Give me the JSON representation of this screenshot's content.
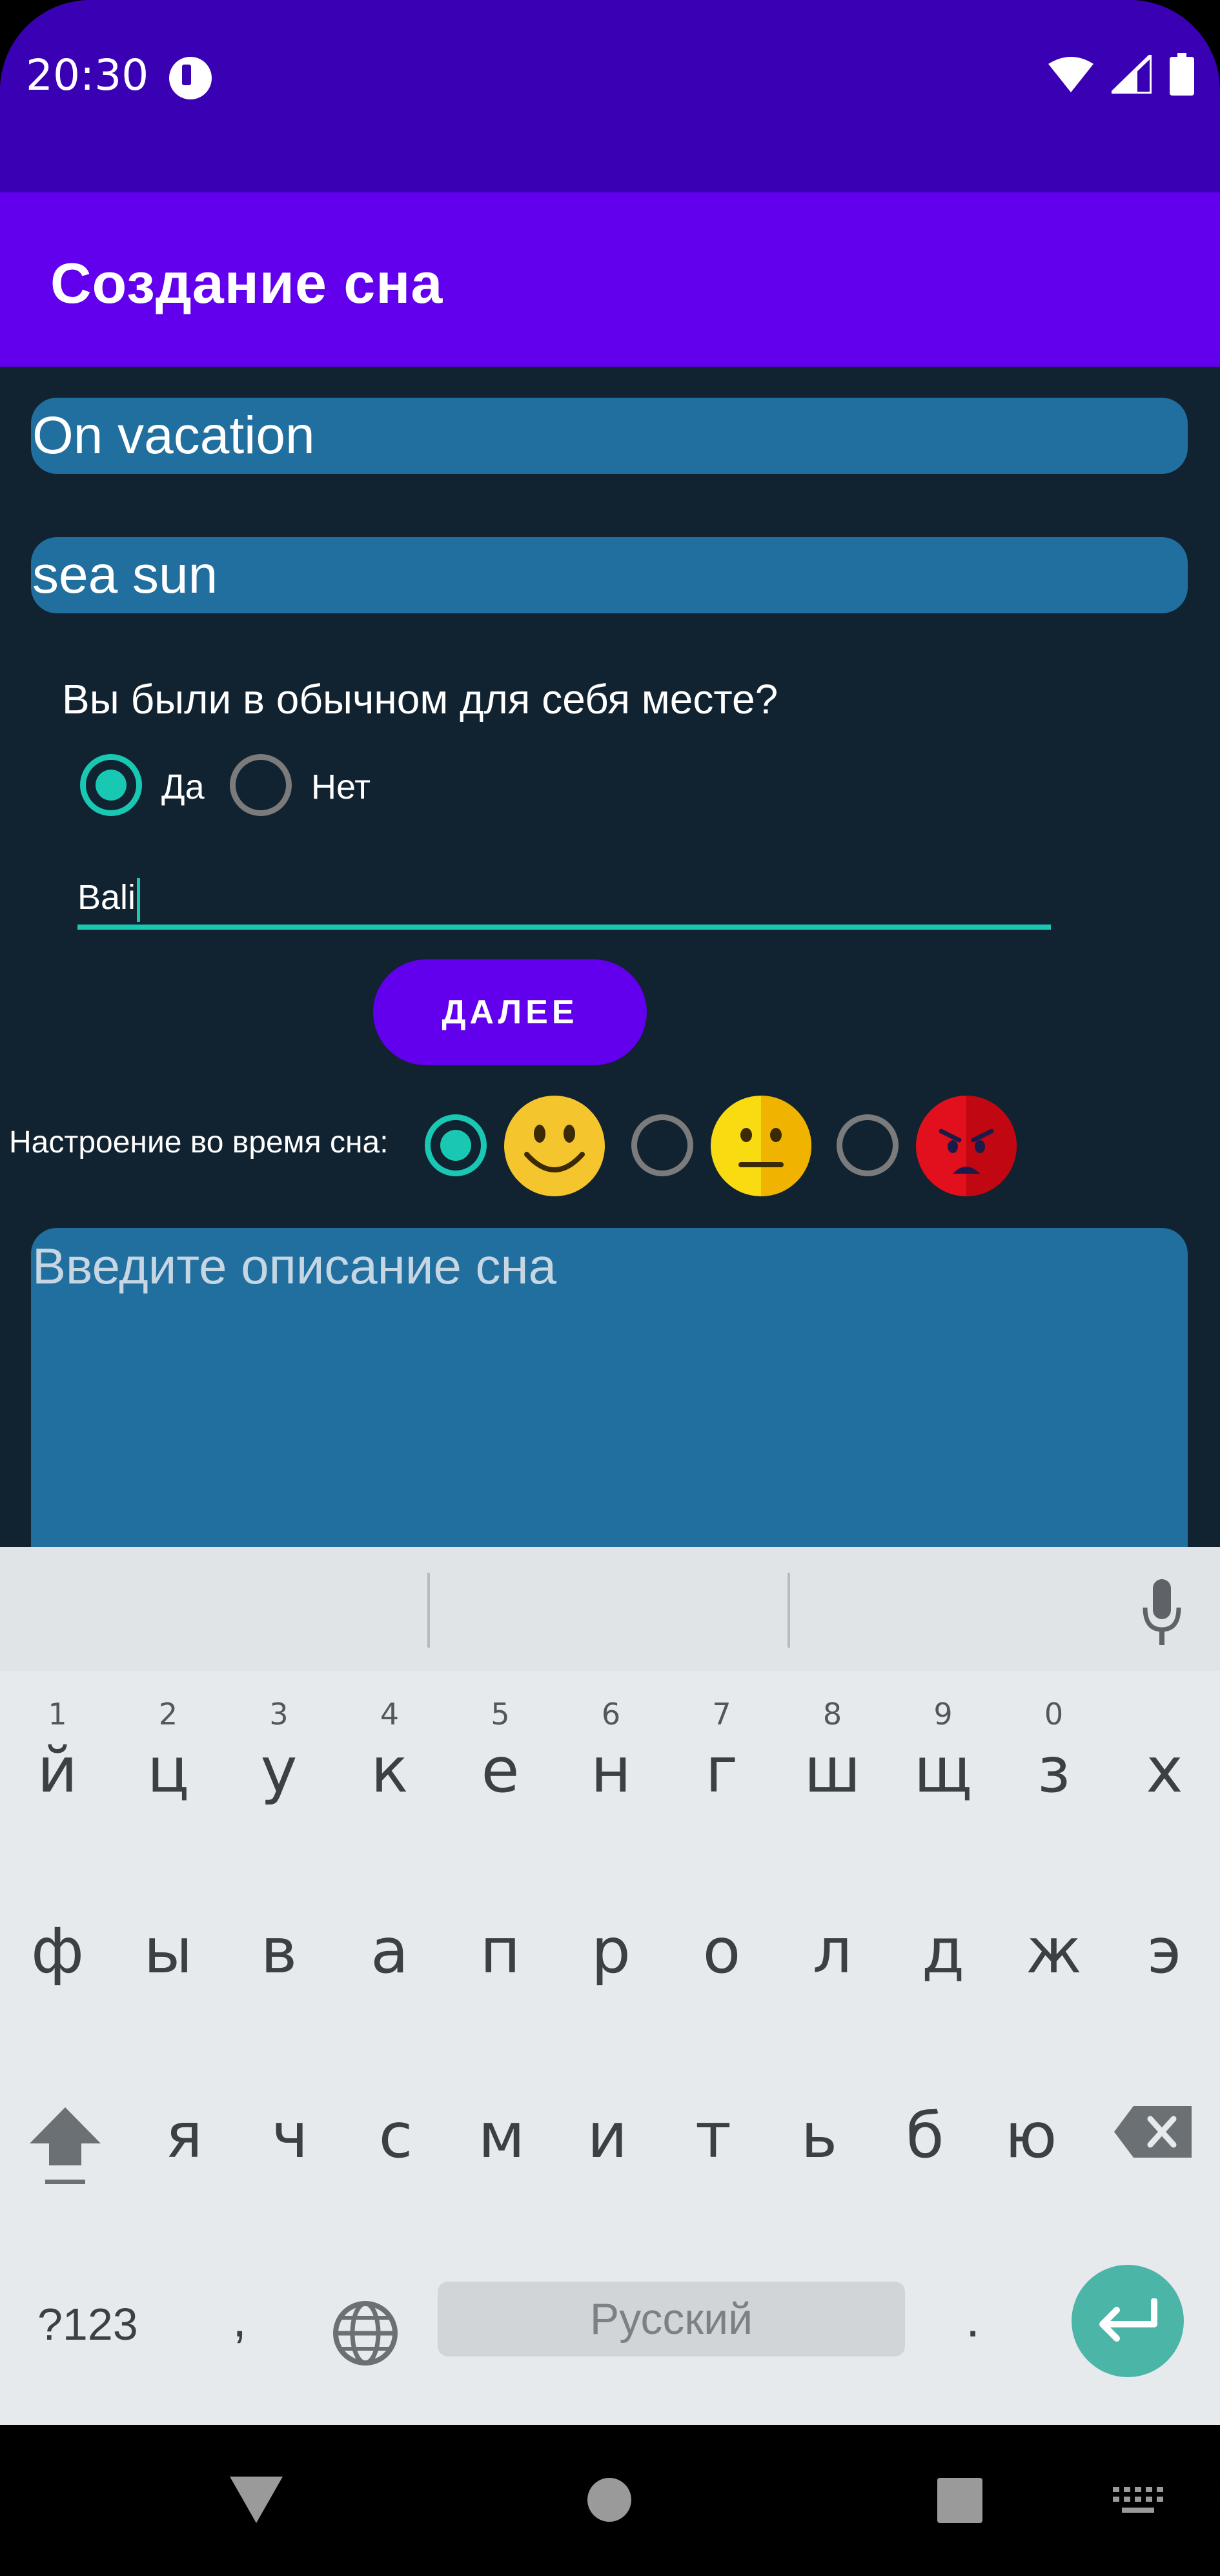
{
  "status": {
    "time": "20:30"
  },
  "app_bar": {
    "title": "Создание сна"
  },
  "form": {
    "title_value": "On vacation",
    "tags_value": "sea sun",
    "usual_place_question": "Вы были в обычном для себя месте?",
    "radio_yes": "Да",
    "radio_no": "Нет",
    "usual_place_selected": "yes",
    "place_value": "Bali",
    "next_button": "ДАЛЕЕ",
    "mood_label": "Настроение во время сна:",
    "mood_selected": "happy",
    "description_placeholder": "Введите описание сна"
  },
  "keyboard": {
    "row1": [
      {
        "ch": "й",
        "hint": "1"
      },
      {
        "ch": "ц",
        "hint": "2"
      },
      {
        "ch": "у",
        "hint": "3"
      },
      {
        "ch": "к",
        "hint": "4"
      },
      {
        "ch": "е",
        "hint": "5"
      },
      {
        "ch": "н",
        "hint": "6"
      },
      {
        "ch": "г",
        "hint": "7"
      },
      {
        "ch": "ш",
        "hint": "8"
      },
      {
        "ch": "щ",
        "hint": "9"
      },
      {
        "ch": "з",
        "hint": "0"
      },
      {
        "ch": "х",
        "hint": ""
      }
    ],
    "row2": [
      "ф",
      "ы",
      "в",
      "а",
      "п",
      "р",
      "о",
      "л",
      "д",
      "ж",
      "э"
    ],
    "row3": [
      "я",
      "ч",
      "с",
      "м",
      "и",
      "т",
      "ь",
      "б",
      "ю"
    ],
    "symbols_key": "?123",
    "comma_key": ",",
    "space_label": "Русский",
    "period_key": ".",
    "theme": {
      "accent": "#4bb5a8",
      "background": "#e7eaed"
    }
  },
  "colors": {
    "status_bar": "#3a00b3",
    "app_bar": "#6200ee",
    "background": "#112230",
    "field": "#216f9f",
    "accent": "#18c8b3"
  }
}
